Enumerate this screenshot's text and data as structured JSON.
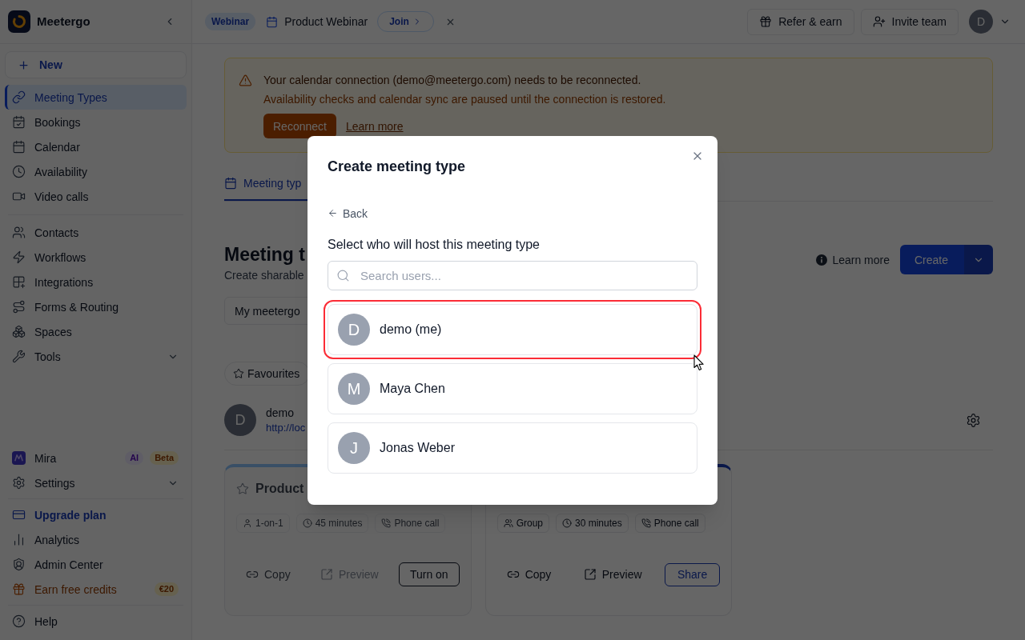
{
  "sidebar": {
    "brand": {
      "name": "Meetergo"
    },
    "new_button": {
      "label": "New"
    },
    "top_groups": [
      [
        {
          "label": "Meeting Types",
          "kind": "nav",
          "selected": true
        },
        {
          "label": "Bookings",
          "kind": "nav",
          "selected": false
        },
        {
          "label": "Calendar",
          "kind": "nav",
          "selected": false
        },
        {
          "label": "Availability",
          "kind": "nav",
          "selected": false
        },
        {
          "label": "Video calls",
          "kind": "nav",
          "selected": false
        }
      ],
      [
        {
          "label": "Contacts",
          "kind": "nav",
          "selected": false
        },
        {
          "label": "Workflows",
          "kind": "nav",
          "selected": false
        },
        {
          "label": "Integrations",
          "kind": "nav",
          "selected": false
        },
        {
          "label": "Forms & Routing",
          "kind": "nav",
          "selected": false
        },
        {
          "label": "Spaces",
          "kind": "nav",
          "selected": false
        },
        {
          "label": "Tools",
          "kind": "nav",
          "selected": false,
          "expanded": false
        }
      ]
    ],
    "bottom_groups": [
      [
        {
          "label": "Mira",
          "kind": "nav",
          "selected": false,
          "badges": [
            {
              "label": "AI",
              "kind": "feature"
            },
            {
              "label": "Beta",
              "kind": "status"
            }
          ]
        },
        {
          "label": "Settings",
          "kind": "nav",
          "selected": false,
          "expanded": false
        }
      ],
      [
        {
          "label": "Upgrade plan",
          "kind": "upgrade",
          "selected": false
        },
        {
          "label": "Analytics",
          "kind": "nav",
          "selected": false
        },
        {
          "label": "Admin Center",
          "kind": "nav",
          "selected": false
        },
        {
          "label": "Earn free credits",
          "kind": "promo",
          "selected": false,
          "badges": [
            {
              "label": "€20",
              "kind": "status"
            }
          ]
        }
      ],
      [
        {
          "label": "Help",
          "kind": "nav",
          "selected": false
        }
      ]
    ]
  },
  "top_bar": {
    "event": {
      "badge": "Webinar",
      "title": "Product Webinar",
      "join_label": "Join"
    },
    "buttons": [
      {
        "label": "Refer & earn"
      },
      {
        "label": "Invite team"
      }
    ],
    "avatar": {
      "initial": "D"
    }
  },
  "alert": {
    "title": "Your calendar connection (demo@meetergo.com) needs to be reconnected.",
    "message": "Availability checks and calendar sync are paused until the connection is restored.",
    "action": "Reconnect",
    "link": "Learn more"
  },
  "tabs": [
    {
      "label": "Meeting typ",
      "selected": true
    }
  ],
  "page_header": {
    "title": "Meeting t",
    "subtitle": "Create sharable",
    "help_link": "Learn more",
    "create_button": "Create"
  },
  "filter": {
    "value": "My meetergo"
  },
  "favourites_filter": {
    "label": "Favourites"
  },
  "owner": {
    "initial": "D",
    "name": "demo",
    "url": "http://loc"
  },
  "cards": [
    {
      "title": "Product",
      "enabled": false,
      "tags": [
        {
          "kind": "one-on-one",
          "label": "1-on-1"
        },
        {
          "kind": "duration",
          "label": "45 minutes"
        },
        {
          "kind": "phone",
          "label": "Phone call"
        }
      ],
      "actions": [
        {
          "kind": "copy",
          "label": "Copy",
          "disabled": false
        },
        {
          "kind": "preview",
          "label": "Preview",
          "disabled": true
        },
        {
          "kind": "toggle",
          "label": "Turn on",
          "disabled": false
        }
      ]
    },
    {
      "enabled": true,
      "tags": [
        {
          "kind": "group",
          "label": "Group"
        },
        {
          "kind": "duration",
          "label": "30 minutes"
        },
        {
          "kind": "phone",
          "label": "Phone call"
        }
      ],
      "actions": [
        {
          "kind": "copy",
          "label": "Copy",
          "disabled": false
        },
        {
          "kind": "preview",
          "label": "Preview",
          "disabled": false
        },
        {
          "kind": "share",
          "label": "Share",
          "disabled": false
        }
      ]
    }
  ],
  "dialog": {
    "title": "Create meeting type",
    "back": "Back",
    "prompt": "Select who will host this meeting type",
    "search": {
      "placeholder": "Search users..."
    },
    "users": [
      {
        "initial": "D",
        "name": "demo (me)",
        "selected": true
      },
      {
        "initial": "M",
        "name": "Maya Chen",
        "selected": false
      },
      {
        "initial": "J",
        "name": "Jonas Weber",
        "selected": false
      }
    ]
  }
}
